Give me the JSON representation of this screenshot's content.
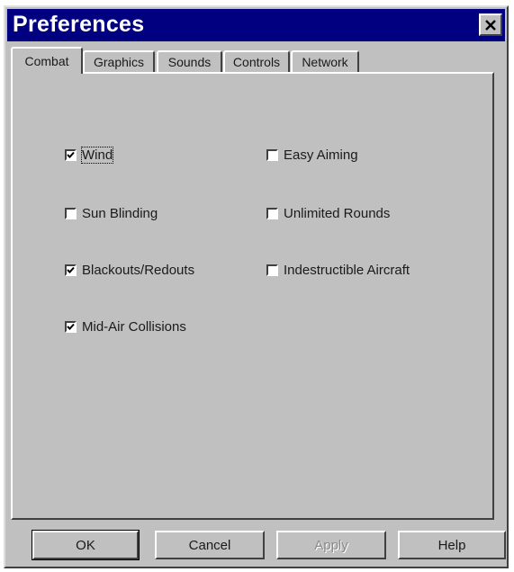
{
  "window": {
    "title": "Preferences"
  },
  "tabs": [
    {
      "label": "Combat"
    },
    {
      "label": "Graphics"
    },
    {
      "label": "Sounds"
    },
    {
      "label": "Controls"
    },
    {
      "label": "Network"
    }
  ],
  "active_tab": "Combat",
  "options": {
    "wind": {
      "label": "Wind",
      "checked": true
    },
    "sun_blinding": {
      "label": "Sun Blinding",
      "checked": false
    },
    "blackouts": {
      "label": "Blackouts/Redouts",
      "checked": true
    },
    "midair": {
      "label": "Mid-Air Collisions",
      "checked": true
    },
    "easy_aiming": {
      "label": "Easy Aiming",
      "checked": false
    },
    "unlimited_rounds": {
      "label": "Unlimited Rounds",
      "checked": false
    },
    "indestructible": {
      "label": "Indestructible Aircraft",
      "checked": false
    }
  },
  "buttons": {
    "ok": "OK",
    "cancel": "Cancel",
    "apply": "Apply",
    "help": "Help"
  },
  "apply_enabled": false
}
